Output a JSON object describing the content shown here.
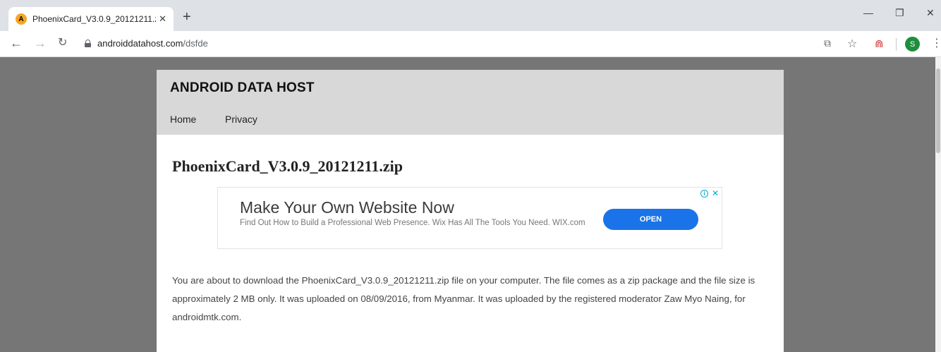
{
  "browser": {
    "tab_title": "PhoenixCard_V3.0.9_20121211.zip",
    "tab_favicon_letter": "A",
    "url_domain": "androiddatahost.com",
    "url_path": "/dsfde",
    "profile_initial": "S"
  },
  "site": {
    "title": "ANDROID DATA HOST",
    "nav": [
      "Home",
      "Privacy"
    ]
  },
  "page": {
    "heading": "PhoenixCard_V3.0.9_20121211.zip",
    "description": "You are about to download the PhoenixCard_V3.0.9_20121211.zip file on your computer. The file comes as a zip package and the file size is approximately 2 MB only. It was uploaded on 08/09/2016, from Myanmar. It was uploaded by the registered moderator Zaw Myo Naing, for androidmtk.com."
  },
  "ad": {
    "headline": "Make Your Own Website Now",
    "description": "Find Out How to Build a Professional Web Presence. Wix Has All The Tools You Need. WIX.com",
    "cta": "OPEN"
  },
  "colors": {
    "page_background": "#767676",
    "header_background": "#d8d8d8",
    "ad_button": "#1a73e8",
    "profile": "#1e8e3e"
  }
}
